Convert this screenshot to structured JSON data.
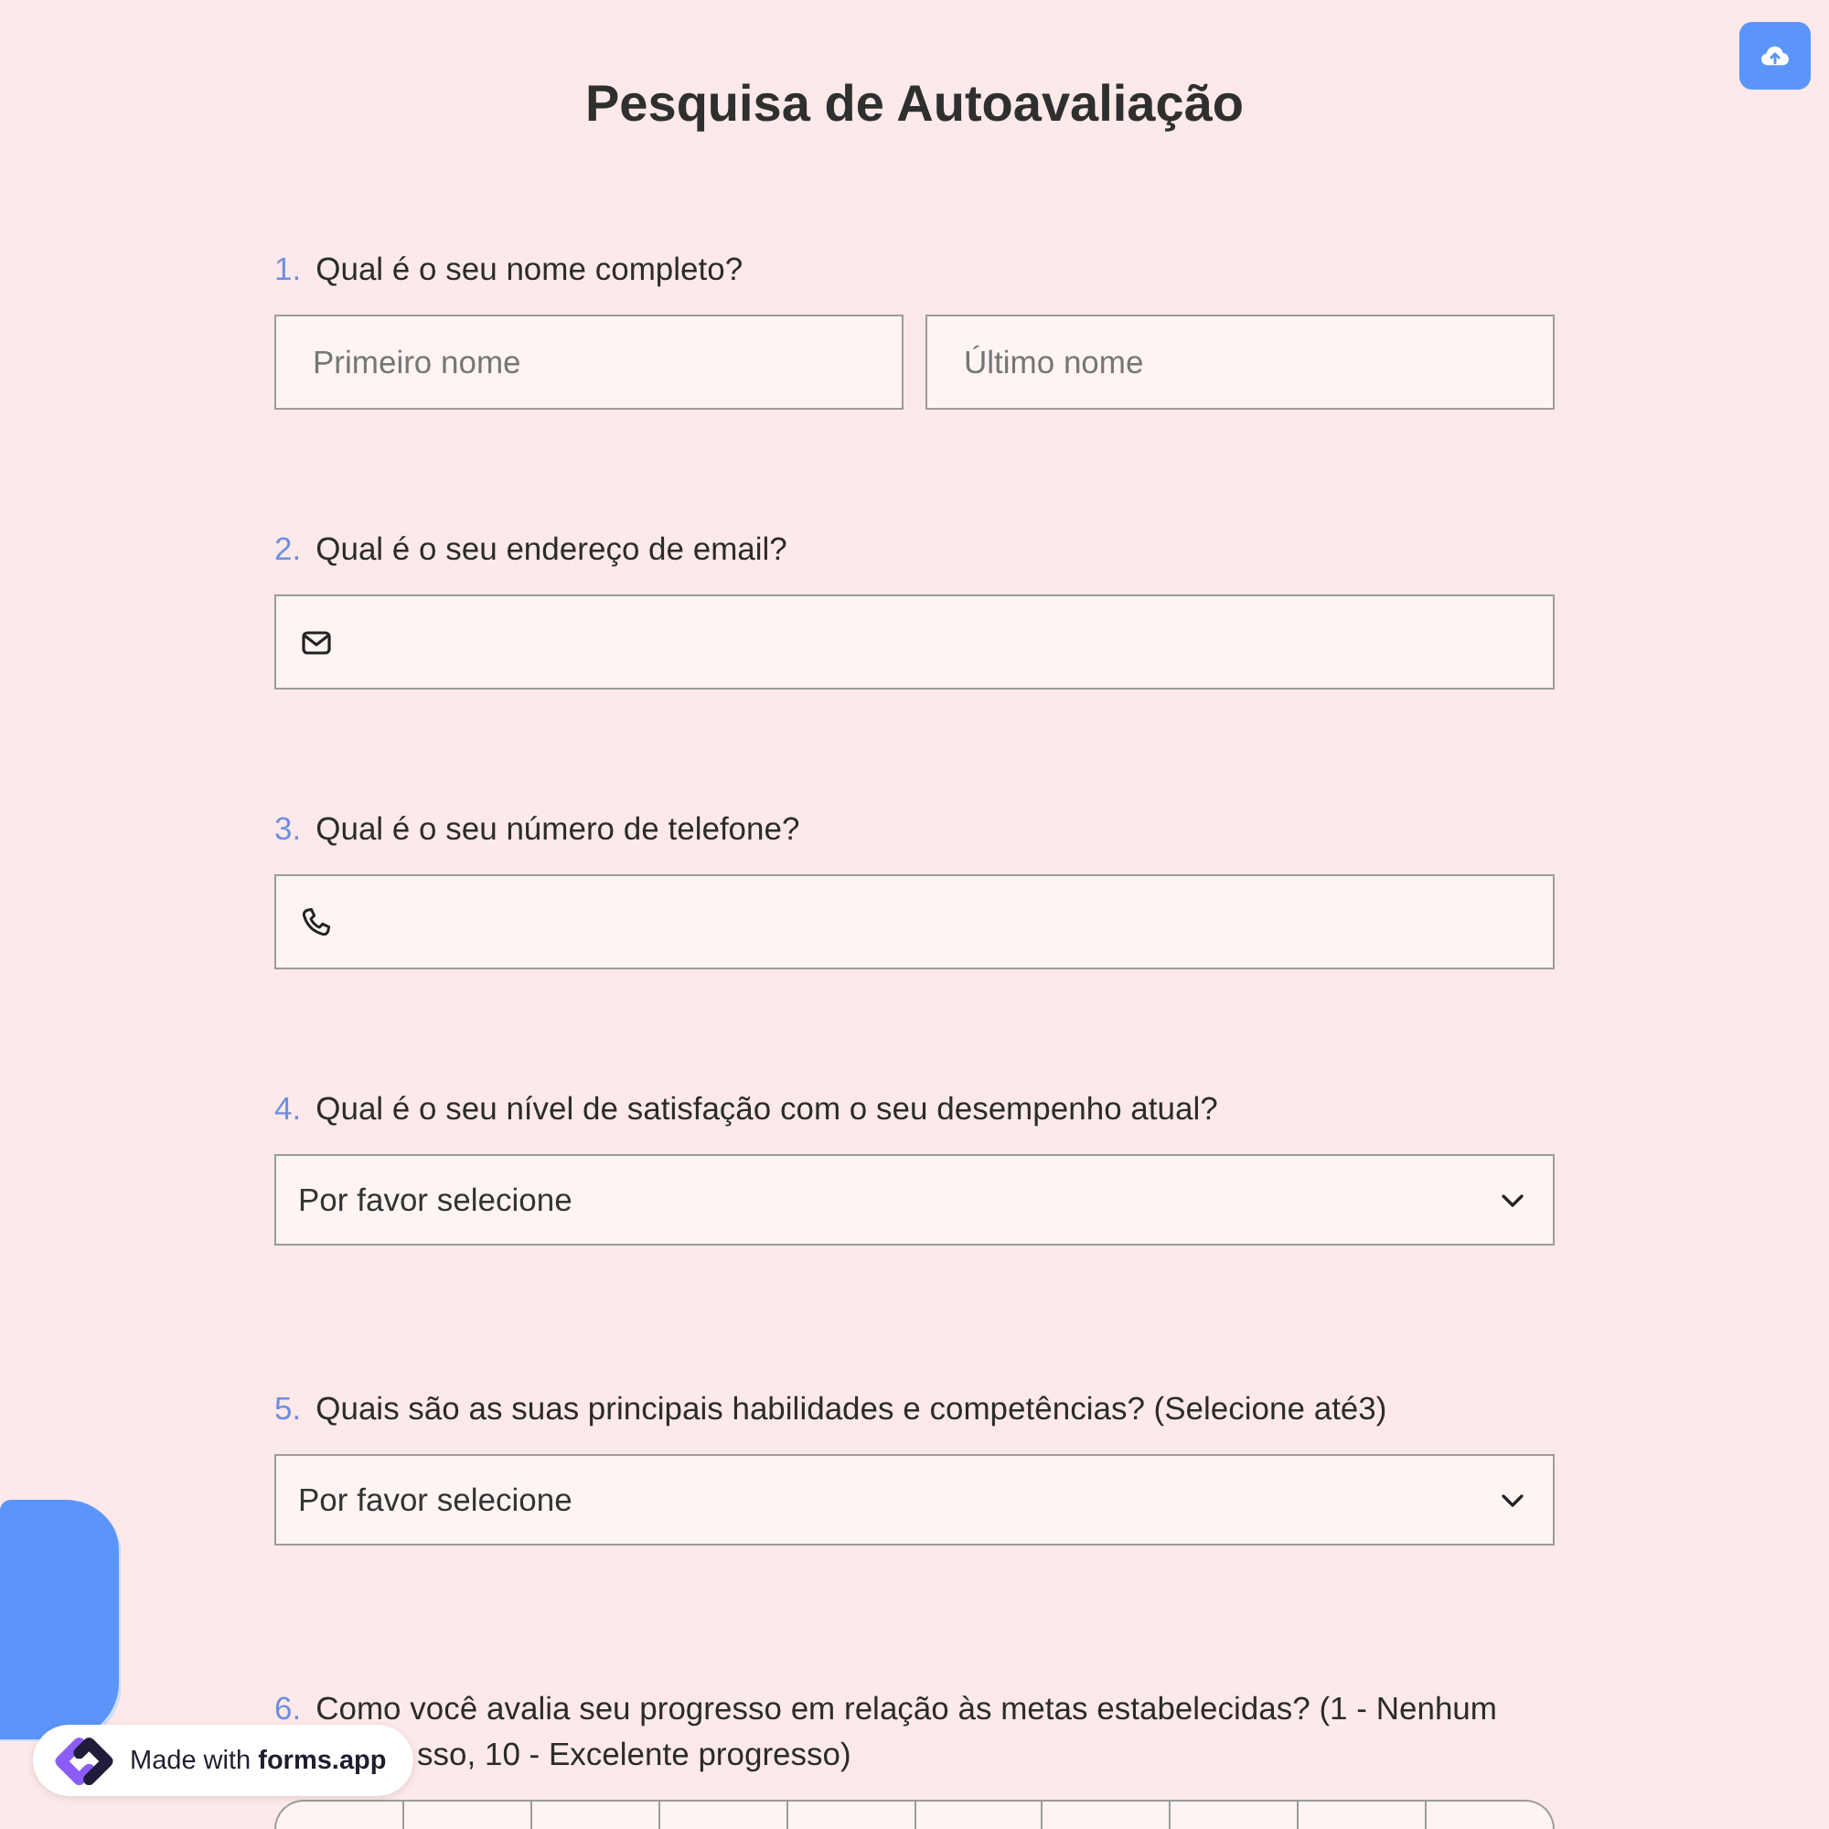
{
  "header": {
    "title": "Pesquisa de Autoavaliação"
  },
  "questions": [
    {
      "kind": "name",
      "number": "1.",
      "text": "Qual é o seu nome completo?",
      "fields": [
        {
          "placeholder": "Primeiro nome"
        },
        {
          "placeholder": "Último nome"
        }
      ]
    },
    {
      "kind": "email",
      "number": "2.",
      "text": "Qual é o seu endereço de email?"
    },
    {
      "kind": "phone",
      "number": "3.",
      "text": "Qual é o seu número de telefone?"
    },
    {
      "kind": "dropdown",
      "number": "4.",
      "text": "Qual é o seu nível de satisfação com o seu desempenho atual?",
      "placeholder": "Por favor selecione"
    },
    {
      "kind": "dropdown",
      "number": "5.",
      "text": "Quais são as suas principais habilidades e competências? (Selecione até3)",
      "placeholder": "Por favor selecione"
    },
    {
      "kind": "scale",
      "number": "6.",
      "text_lines": [
        "Como você avalia seu progresso em relação às metas estabelecidas? (1 - Nenhum",
        "sso, 10 - Excelente progresso)"
      ],
      "options": [
        {
          "selected": false
        },
        {
          "selected": false
        },
        {
          "selected": false
        },
        {
          "selected": false
        },
        {
          "selected": false
        },
        {
          "selected": false
        },
        {
          "selected": false
        },
        {
          "selected": false
        },
        {
          "selected": false
        },
        {
          "selected": false
        }
      ]
    }
  ],
  "badge": {
    "text": "Made with **forms.app**"
  }
}
